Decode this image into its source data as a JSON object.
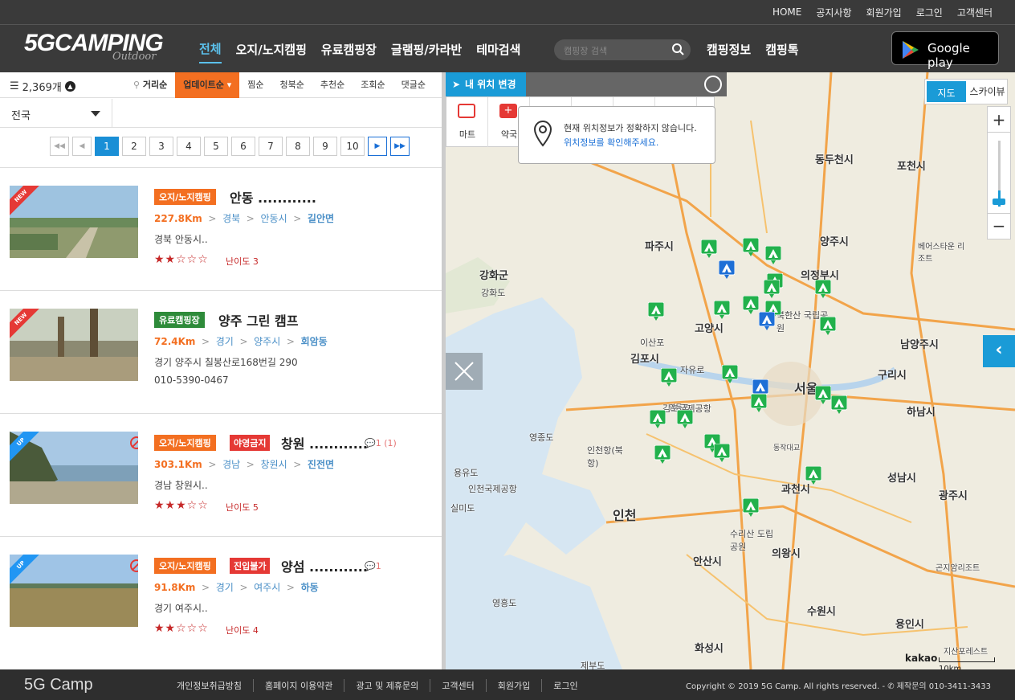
{
  "topbar": {
    "links": [
      "HOME",
      "공지사항",
      "회원가입",
      "로그인",
      "고객센터"
    ]
  },
  "header": {
    "logo_text": "5GCAMPING",
    "logo_sub": "Outdoor",
    "nav": [
      "전체",
      "오지/노지캠핑",
      "유료캠핑장",
      "글램핑/카라반",
      "테마검색"
    ],
    "search_placeholder": "캠핑장 검색",
    "nav2": [
      "캠핑정보",
      "캠핑톡"
    ],
    "google_play": "Google play"
  },
  "left": {
    "count": "2,369개",
    "distance_label": "거리순",
    "sorts": [
      "업데이트순",
      "찜순",
      "청북순",
      "추천순",
      "조회순",
      "댓글순"
    ],
    "active_sort": "업데이트순",
    "region": "전국",
    "pages": [
      "1",
      "2",
      "3",
      "4",
      "5",
      "6",
      "7",
      "8",
      "9",
      "10"
    ],
    "current_page": "1",
    "items": [
      {
        "badge": "NEW",
        "category": "오지/노지캠핑",
        "cat_color": "#f36f21",
        "name": "안동 ............",
        "km": "227.8Km",
        "loc": [
          "경북",
          "안동시",
          "길안면"
        ],
        "addr": "경북 안동시..",
        "stars": "★★☆☆☆",
        "difficulty": "난이도 3"
      },
      {
        "badge": "NEW",
        "category": "유료캠핑장",
        "cat_color": "#2e8b3a",
        "name": "양주 그린 캠프",
        "km": "72.4Km",
        "loc": [
          "경기",
          "양주시",
          "회암동"
        ],
        "addr": "경기 양주시 칠봉산로168번길 290",
        "tel": "010-5390-0467"
      },
      {
        "badge": "UP",
        "category": "오지/노지캠핑",
        "cat_color": "#f36f21",
        "warn": "야영금지",
        "name": "창원 ............",
        "comment": "1 (1)",
        "km": "303.1Km",
        "loc": [
          "경남",
          "창원시",
          "진전면"
        ],
        "addr": "경남 창원시..",
        "stars": "★★★☆☆",
        "difficulty": "난이도 5"
      },
      {
        "badge": "UP",
        "category": "오지/노지캠핑",
        "cat_color": "#f36f21",
        "warn": "진입불가",
        "name": "양섬 ............",
        "comment": "1",
        "km": "91.8Km",
        "loc": [
          "경기",
          "여주시",
          "하동"
        ],
        "addr": "경기 여주시..",
        "stars": "★★☆☆☆",
        "difficulty": "난이도 4"
      }
    ]
  },
  "map": {
    "my_location": "내 위치 변경",
    "poi": [
      "마트",
      "약국"
    ],
    "tooltip_line1": "현재 위치정보가 정확하지 않습니다.",
    "tooltip_line2": "위치정보를 확인해주세요.",
    "map_types": [
      "지도",
      "스카이뷰"
    ],
    "active_type": "지도",
    "zoom_in": "+",
    "zoom_out": "−",
    "attribution": "kakao",
    "scale_label": "10km",
    "cities": [
      {
        "name": "동두천시"
      },
      {
        "name": "포천시"
      },
      {
        "name": "파주시"
      },
      {
        "name": "양주시"
      },
      {
        "name": "의정부시"
      },
      {
        "name": "강화군"
      },
      {
        "name": "고양시"
      },
      {
        "name": "남양주시"
      },
      {
        "name": "김포시"
      },
      {
        "name": "구리시"
      },
      {
        "name": "서울"
      },
      {
        "name": "하남시"
      },
      {
        "name": "인천"
      },
      {
        "name": "과천시"
      },
      {
        "name": "성남시"
      },
      {
        "name": "광주시"
      },
      {
        "name": "안산시"
      },
      {
        "name": "의왕시"
      },
      {
        "name": "수원시"
      },
      {
        "name": "용인시"
      },
      {
        "name": "화성시"
      }
    ],
    "small_labels": [
      "강화도",
      "이산포",
      "자유로",
      "김포국제공항",
      "영종도",
      "인천국제공항",
      "실미도",
      "용유도",
      "인천항(북항)",
      "동작대교",
      "수리산 도립공원",
      "영흥도",
      "북한산 국립공원",
      "베어스타운 리조트",
      "곤지암리조트",
      "지산포레스트",
      "제부도",
      "영등포"
    ]
  },
  "footer": {
    "logo": "5G Camp",
    "links": [
      "개인정보취급방침",
      "홈페이지 이용약관",
      "광고 및 제휴문의",
      "고객센터",
      "회원가입",
      "로그인"
    ],
    "copyright": "Copyright © 2019 5G Camp. All rights reserved. - ✆ 제작문의 010-3411-3433"
  }
}
